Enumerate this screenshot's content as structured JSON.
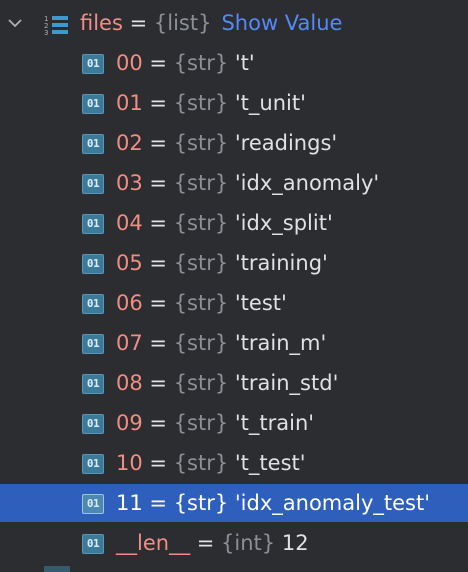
{
  "root": {
    "name": "files",
    "eq": " = ",
    "type": "{list}",
    "action": "Show Value"
  },
  "icon_badge": "01",
  "items": [
    {
      "name": "00",
      "type": "{str}",
      "value": "'t'"
    },
    {
      "name": "01",
      "type": "{str}",
      "value": "'t_unit'"
    },
    {
      "name": "02",
      "type": "{str}",
      "value": "'readings'"
    },
    {
      "name": "03",
      "type": "{str}",
      "value": "'idx_anomaly'"
    },
    {
      "name": "04",
      "type": "{str}",
      "value": "'idx_split'"
    },
    {
      "name": "05",
      "type": "{str}",
      "value": "'training'"
    },
    {
      "name": "06",
      "type": "{str}",
      "value": "'test'"
    },
    {
      "name": "07",
      "type": "{str}",
      "value": "'train_m'"
    },
    {
      "name": "08",
      "type": "{str}",
      "value": "'train_std'"
    },
    {
      "name": "09",
      "type": "{str}",
      "value": "'t_train'"
    },
    {
      "name": "10",
      "type": "{str}",
      "value": "'t_test'"
    },
    {
      "name": "11",
      "type": "{str}",
      "value": "'idx_anomaly_test'"
    },
    {
      "name": "__len__",
      "type": "{int}",
      "value": "12"
    }
  ],
  "selected_index": 11,
  "colors": {
    "background": "#2b2d30",
    "selection": "#2e5fbd",
    "name": "#f08d85",
    "type": "#8c8f94",
    "link": "#548af7",
    "icon": "#3c7a9a"
  },
  "icons": {
    "root_toggle": "chevron-down-icon",
    "root_type": "list-icon",
    "item_type": "variable-icon"
  }
}
